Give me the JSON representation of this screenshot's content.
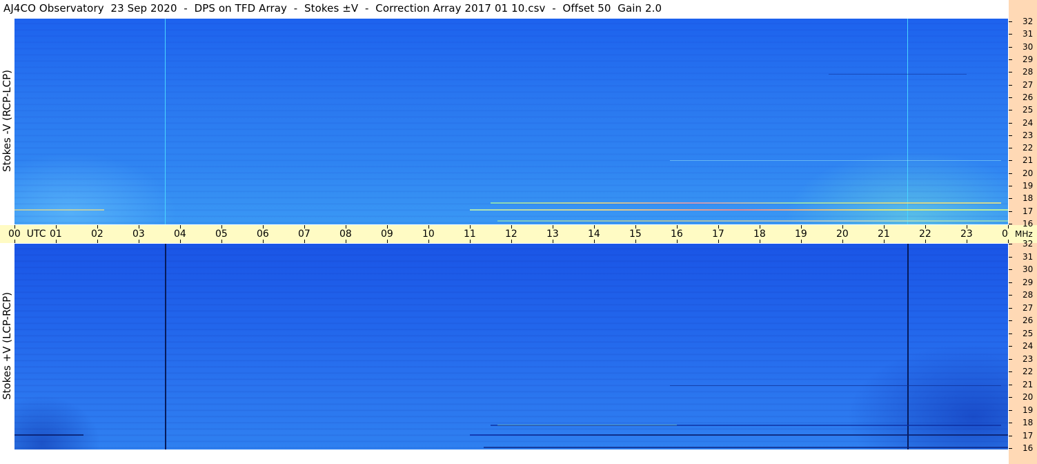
{
  "title": "AJ4CO Observatory  23 Sep 2020  -  DPS on TFD Array  -  Stokes ±V  -  Correction Array 2017 01 10.csv  -  Offset 50  Gain 2.0",
  "panels": {
    "top": {
      "ylabel": "Stokes -V (RCP-LCP)"
    },
    "bottom": {
      "ylabel": "Stokes +V (LCP-RCP)"
    }
  },
  "time_axis": {
    "first_label": "00  UTC",
    "labels": [
      "01",
      "02",
      "03",
      "04",
      "05",
      "06",
      "07",
      "08",
      "09",
      "10",
      "11",
      "12",
      "13",
      "14",
      "15",
      "16",
      "17",
      "18",
      "19",
      "20",
      "21",
      "22",
      "23",
      "00"
    ],
    "unit": "MHz"
  },
  "freq_axis": {
    "labels": [
      "32",
      "31",
      "30",
      "29",
      "28",
      "27",
      "26",
      "25",
      "24",
      "23",
      "22",
      "21",
      "20",
      "19",
      "18",
      "17",
      "16"
    ]
  },
  "colors": {
    "spectrogram_base": "#2a78f0",
    "time_axis_bg": "#fffbc4",
    "freq_axis_bg": "#ffd9b5"
  }
}
